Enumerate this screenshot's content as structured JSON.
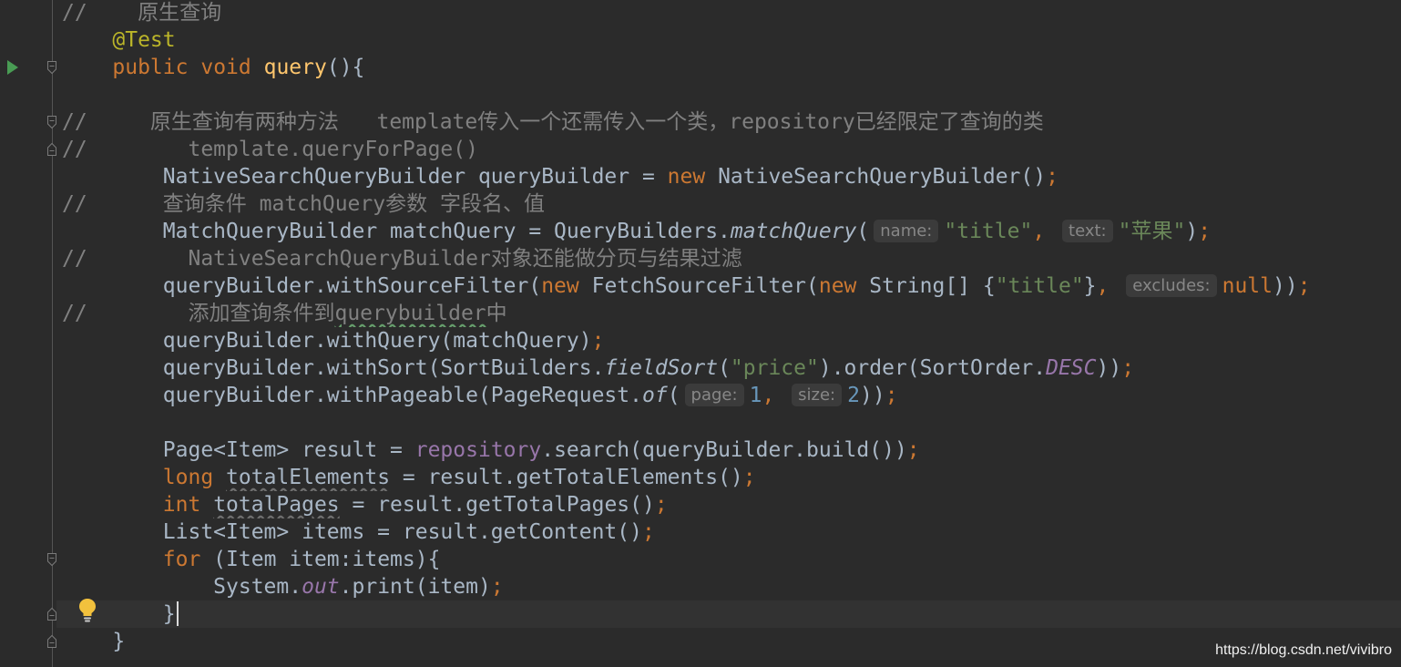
{
  "editor": {
    "theme": {
      "background": "#2b2b2b",
      "current_line": "#323232",
      "plain": "#a9b7c6",
      "keyword": "#cc7832",
      "comment": "#808080",
      "string": "#6a8759",
      "number": "#6897bb",
      "annotation": "#bbb529",
      "method_decl": "#ffc66d",
      "field": "#9876aa",
      "hint_background": "#3b3b3b",
      "hint_text": "#878787",
      "typo_underline": "#659c6b",
      "unused_underline": "#6e6e6e",
      "run_icon": "#499c54",
      "bulb_icon": "#f2c13d"
    },
    "lines": [
      {
        "tokens": [
          {
            "text": "//    原生查询",
            "kind": "comment"
          }
        ]
      },
      {
        "tokens": [
          {
            "text": "    ",
            "kind": "plain"
          },
          {
            "text": "@Test",
            "kind": "annotation"
          }
        ]
      },
      {
        "gutter": [
          "run-icon",
          "fold-start-icon"
        ],
        "tokens": [
          {
            "text": "    ",
            "kind": "plain"
          },
          {
            "text": "public",
            "kind": "keyword"
          },
          {
            "text": " ",
            "kind": "plain"
          },
          {
            "text": "void",
            "kind": "keyword"
          },
          {
            "text": " ",
            "kind": "plain"
          },
          {
            "text": "query",
            "kind": "method-decl"
          },
          {
            "text": "(){",
            "kind": "plain"
          }
        ]
      },
      {
        "tokens": []
      },
      {
        "gutter": [
          "fold-start-icon"
        ],
        "tokens": [
          {
            "text": "//     原生查询有两种方法   template传入一个还需传入一个类，repository已经限定了查询的类",
            "kind": "comment"
          }
        ]
      },
      {
        "gutter": [
          "fold-end-icon"
        ],
        "tokens": [
          {
            "text": "//        template.queryForPage()",
            "kind": "comment"
          }
        ]
      },
      {
        "tokens": [
          {
            "text": "        NativeSearchQueryBuilder queryBuilder = ",
            "kind": "plain"
          },
          {
            "text": "new",
            "kind": "keyword"
          },
          {
            "text": " NativeSearchQueryBuilder()",
            "kind": "plain"
          },
          {
            "text": ";",
            "kind": "keyword"
          }
        ]
      },
      {
        "tokens": [
          {
            "text": "//      查询条件 matchQuery参数 字段名、值",
            "kind": "comment"
          }
        ]
      },
      {
        "tokens": [
          {
            "text": "        MatchQueryBuilder matchQuery = QueryBuilders.",
            "kind": "plain"
          },
          {
            "text": "matchQuery",
            "kind": "static-method"
          },
          {
            "text": "(",
            "kind": "plain"
          },
          {
            "text": "name:",
            "kind": "hint"
          },
          {
            "text": "\"title\"",
            "kind": "string"
          },
          {
            "text": ",",
            "kind": "keyword"
          },
          {
            "text": " ",
            "kind": "plain"
          },
          {
            "text": "text:",
            "kind": "hint"
          },
          {
            "text": "\"苹果\"",
            "kind": "string"
          },
          {
            "text": ")",
            "kind": "plain"
          },
          {
            "text": ";",
            "kind": "keyword"
          }
        ]
      },
      {
        "tokens": [
          {
            "text": "//        NativeSearchQueryBuilder对象还能做分页与结果过滤",
            "kind": "comment"
          }
        ]
      },
      {
        "tokens": [
          {
            "text": "        queryBuilder.withSourceFilter(",
            "kind": "plain"
          },
          {
            "text": "new",
            "kind": "keyword"
          },
          {
            "text": " FetchSourceFilter(",
            "kind": "plain"
          },
          {
            "text": "new",
            "kind": "keyword"
          },
          {
            "text": " String[] {",
            "kind": "plain"
          },
          {
            "text": "\"title\"",
            "kind": "string"
          },
          {
            "text": "}",
            "kind": "plain"
          },
          {
            "text": ",",
            "kind": "keyword"
          },
          {
            "text": " ",
            "kind": "plain"
          },
          {
            "text": "excludes:",
            "kind": "hint"
          },
          {
            "text": "null",
            "kind": "keyword"
          },
          {
            "text": "))",
            "kind": "plain"
          },
          {
            "text": ";",
            "kind": "keyword"
          }
        ]
      },
      {
        "tokens": [
          {
            "text": "//        添加查询条件到",
            "kind": "comment"
          },
          {
            "text": "querybuilder",
            "kind": "comment-typo"
          },
          {
            "text": "中",
            "kind": "comment"
          }
        ]
      },
      {
        "tokens": [
          {
            "text": "        queryBuilder.withQuery(matchQuery)",
            "kind": "plain"
          },
          {
            "text": ";",
            "kind": "keyword"
          }
        ]
      },
      {
        "tokens": [
          {
            "text": "        queryBuilder.withSort(SortBuilders.",
            "kind": "plain"
          },
          {
            "text": "fieldSort",
            "kind": "static-method"
          },
          {
            "text": "(",
            "kind": "plain"
          },
          {
            "text": "\"price\"",
            "kind": "string"
          },
          {
            "text": ").order(SortOrder.",
            "kind": "plain"
          },
          {
            "text": "DESC",
            "kind": "static-field"
          },
          {
            "text": "))",
            "kind": "plain"
          },
          {
            "text": ";",
            "kind": "keyword"
          }
        ]
      },
      {
        "tokens": [
          {
            "text": "        queryBuilder.withPageable(PageRequest.",
            "kind": "plain"
          },
          {
            "text": "of",
            "kind": "static-method"
          },
          {
            "text": "(",
            "kind": "plain"
          },
          {
            "text": "page:",
            "kind": "hint"
          },
          {
            "text": "1",
            "kind": "number"
          },
          {
            "text": ",",
            "kind": "keyword"
          },
          {
            "text": " ",
            "kind": "plain"
          },
          {
            "text": "size:",
            "kind": "hint"
          },
          {
            "text": "2",
            "kind": "number"
          },
          {
            "text": "))",
            "kind": "plain"
          },
          {
            "text": ";",
            "kind": "keyword"
          }
        ]
      },
      {
        "tokens": []
      },
      {
        "tokens": [
          {
            "text": "        Page<Item> result = ",
            "kind": "plain"
          },
          {
            "text": "repository",
            "kind": "field"
          },
          {
            "text": ".search(queryBuilder.build())",
            "kind": "plain"
          },
          {
            "text": ";",
            "kind": "keyword"
          }
        ]
      },
      {
        "tokens": [
          {
            "text": "        ",
            "kind": "plain"
          },
          {
            "text": "long",
            "kind": "keyword"
          },
          {
            "text": " ",
            "kind": "plain"
          },
          {
            "text": "totalElements",
            "kind": "unused"
          },
          {
            "text": " = result.getTotalElements()",
            "kind": "plain"
          },
          {
            "text": ";",
            "kind": "keyword"
          }
        ]
      },
      {
        "tokens": [
          {
            "text": "        ",
            "kind": "plain"
          },
          {
            "text": "int",
            "kind": "keyword"
          },
          {
            "text": " ",
            "kind": "plain"
          },
          {
            "text": "totalPages",
            "kind": "unused"
          },
          {
            "text": " = result.getTotalPages()",
            "kind": "plain"
          },
          {
            "text": ";",
            "kind": "keyword"
          }
        ]
      },
      {
        "tokens": [
          {
            "text": "        List<Item> items = result.getContent()",
            "kind": "plain"
          },
          {
            "text": ";",
            "kind": "keyword"
          }
        ]
      },
      {
        "gutter": [
          "fold-start-icon"
        ],
        "tokens": [
          {
            "text": "        ",
            "kind": "plain"
          },
          {
            "text": "for",
            "kind": "keyword"
          },
          {
            "text": " (Item item:items){",
            "kind": "plain"
          }
        ]
      },
      {
        "tokens": [
          {
            "text": "            System.",
            "kind": "plain"
          },
          {
            "text": "out",
            "kind": "static-field"
          },
          {
            "text": ".print(item)",
            "kind": "plain"
          },
          {
            "text": ";",
            "kind": "keyword"
          }
        ]
      },
      {
        "gutter": [
          "fold-end-icon",
          "bulb-icon"
        ],
        "current": true,
        "caret": true,
        "tokens": [
          {
            "text": "        }",
            "kind": "plain"
          }
        ]
      },
      {
        "gutter": [
          "fold-end-icon"
        ],
        "tokens": [
          {
            "text": "    }",
            "kind": "plain"
          }
        ]
      }
    ]
  },
  "watermark": {
    "text": "https://blog.csdn.net/vivibro"
  }
}
